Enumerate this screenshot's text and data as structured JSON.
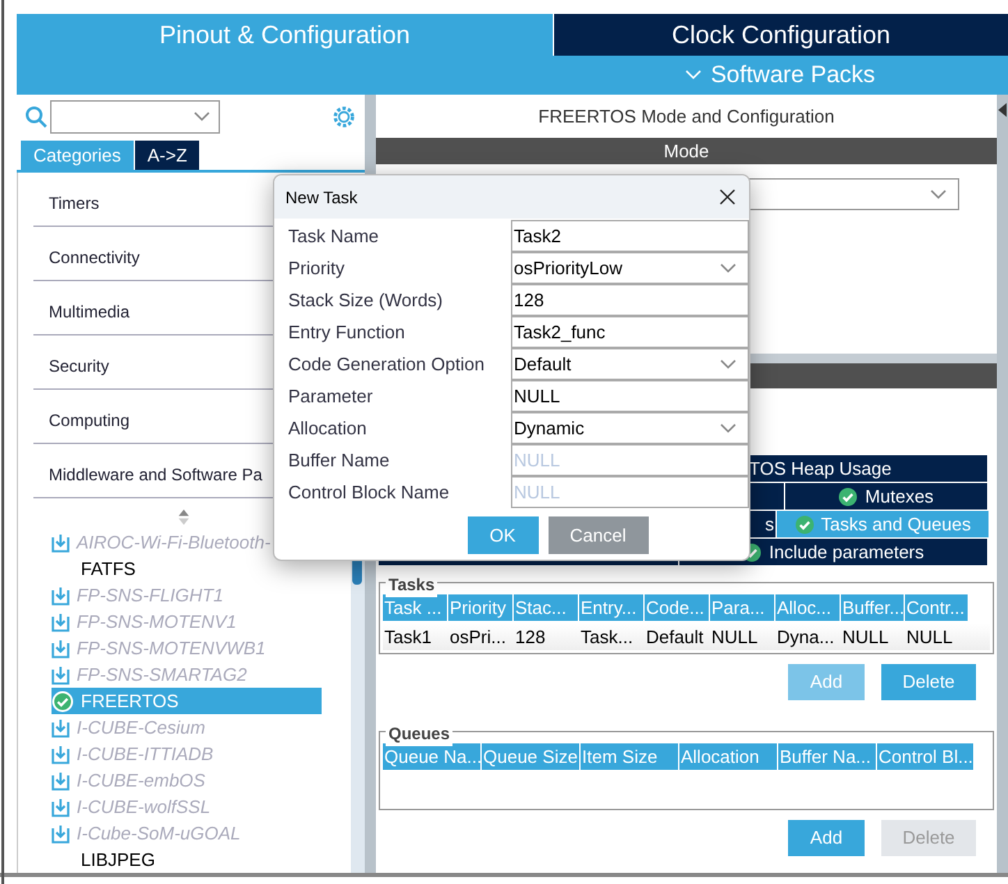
{
  "top_tabs": [
    {
      "label": "Pinout & Configuration",
      "selected": true
    },
    {
      "label": "Clock Configuration",
      "selected": false
    }
  ],
  "software_packs": "Software Packs",
  "left_panel": {
    "view_tabs": [
      {
        "label": "Categories",
        "selected": true
      },
      {
        "label": "A->Z",
        "selected": false
      }
    ],
    "categories": [
      "Timers",
      "Connectivity",
      "Multimedia",
      "Security",
      "Computing",
      "Middleware and Software Pa"
    ],
    "packs": [
      {
        "label": "AIROC-Wi-Fi-Bluetooth-",
        "kind": "download",
        "selected": false
      },
      {
        "label": "FATFS",
        "kind": "plain",
        "selected": false
      },
      {
        "label": "FP-SNS-FLIGHT1",
        "kind": "download",
        "selected": false
      },
      {
        "label": "FP-SNS-MOTENV1",
        "kind": "download",
        "selected": false
      },
      {
        "label": "FP-SNS-MOTENVWB1",
        "kind": "download",
        "selected": false
      },
      {
        "label": "FP-SNS-SMARTAG2",
        "kind": "download",
        "selected": false
      },
      {
        "label": "FREERTOS",
        "kind": "enabled",
        "selected": true
      },
      {
        "label": "I-CUBE-Cesium",
        "kind": "download",
        "selected": false
      },
      {
        "label": "I-CUBE-ITTIADB",
        "kind": "download",
        "selected": false
      },
      {
        "label": "I-CUBE-embOS",
        "kind": "download",
        "selected": false
      },
      {
        "label": "I-CUBE-wolfSSL",
        "kind": "download",
        "selected": false
      },
      {
        "label": "I-Cube-SoM-uGOAL",
        "kind": "download",
        "selected": false
      },
      {
        "label": "LIBJPEG",
        "kind": "plain",
        "selected": false
      }
    ]
  },
  "right_panel": {
    "title": "FREERTOS Mode and Configuration",
    "mode_header": "Mode",
    "config_tabs": [
      [
        {
          "label": "TOS Heap Usage",
          "checked": false,
          "selected": false
        }
      ],
      [
        {
          "label": "Mutexes",
          "checked": true,
          "selected": false
        }
      ],
      [
        {
          "label": "s",
          "checked": false,
          "selected": false
        },
        {
          "label": "Tasks and Queues",
          "checked": true,
          "selected": true
        }
      ],
      [
        {
          "label": "Include parameters",
          "checked": true,
          "selected": false
        }
      ]
    ],
    "tasks": {
      "legend": "Tasks",
      "columns": [
        "Task ...",
        "Priority",
        "Stac...",
        "Entry...",
        "Code...",
        "Para...",
        "Alloc...",
        "Buffer...",
        "Contr..."
      ],
      "rows": [
        [
          "Task1",
          "osPri...",
          "128",
          "Task...",
          "Default",
          "NULL",
          "Dyna...",
          "NULL",
          "NULL"
        ]
      ],
      "buttons": [
        {
          "label": "Add",
          "disabled": true
        },
        {
          "label": "Delete",
          "disabled": false
        }
      ]
    },
    "queues": {
      "legend": "Queues",
      "columns": [
        "Queue Na...",
        "Queue Size",
        "Item Size",
        "Allocation",
        "Buffer Na...",
        "Control Bl..."
      ],
      "buttons": [
        {
          "label": "Add",
          "disabled": false
        },
        {
          "label": "Delete",
          "disabled": true
        }
      ]
    }
  },
  "dialog": {
    "title": "New Task",
    "fields": [
      {
        "label": "Task Name",
        "value": "Task2",
        "kind": "text",
        "disabled": false
      },
      {
        "label": "Priority",
        "value": "osPriorityLow",
        "kind": "select",
        "disabled": false
      },
      {
        "label": "Stack Size (Words)",
        "value": "128",
        "kind": "text",
        "disabled": false
      },
      {
        "label": "Entry Function",
        "value": "Task2_func",
        "kind": "text",
        "disabled": false
      },
      {
        "label": "Code Generation Option",
        "value": "Default",
        "kind": "select",
        "disabled": false
      },
      {
        "label": "Parameter",
        "value": "NULL",
        "kind": "text",
        "disabled": false
      },
      {
        "label": "Allocation",
        "value": "Dynamic",
        "kind": "select",
        "disabled": false
      },
      {
        "label": "Buffer Name",
        "value": "NULL",
        "kind": "text",
        "disabled": true
      },
      {
        "label": "Control Block Name",
        "value": "NULL",
        "kind": "text",
        "disabled": true
      }
    ],
    "buttons": [
      {
        "label": "OK",
        "kind": "primary"
      },
      {
        "label": "Cancel",
        "kind": "secondary"
      }
    ]
  }
}
